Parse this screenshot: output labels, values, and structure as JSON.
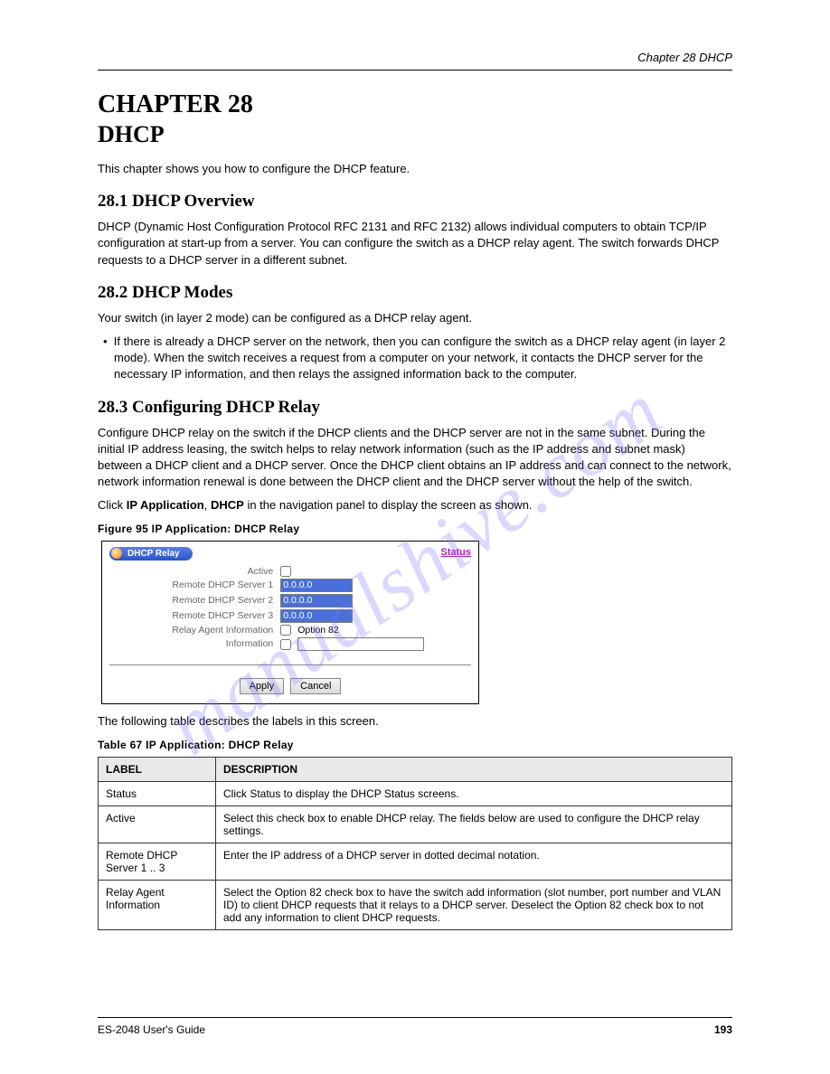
{
  "header": {
    "right": "Chapter 28 DHCP"
  },
  "chapter": {
    "num_title": "CHAPTER 28",
    "title": "DHCP"
  },
  "p_intro": "This chapter shows you how to configure the DHCP feature.",
  "s1": {
    "heading": "28.1  DHCP Overview",
    "text": "DHCP (Dynamic Host Configuration Protocol RFC 2131 and RFC 2132) allows individual computers to obtain TCP/IP configuration at start-up from a server. You can configure the switch as a DHCP relay agent. The switch forwards DHCP requests to a DHCP server in a different subnet."
  },
  "s2": {
    "heading": "28.2  DHCP Modes",
    "text": "Your switch (in layer 2 mode) can be configured as a DHCP relay agent.",
    "bullet": "If there is already a DHCP server on the network, then you can configure the switch as a DHCP relay agent (in layer 2 mode). When the switch receives a request from a computer on your network, it contacts the DHCP server for the necessary IP information, and then relays the assigned information back to the computer."
  },
  "s3": {
    "heading": "28.3  Configuring DHCP Relay",
    "p1": "Configure DHCP relay on the switch if the DHCP clients and the DHCP server are not in the same subnet. During the initial IP address leasing, the switch helps to relay network information (such as the IP address and subnet mask) between a DHCP client and a DHCP server. Once the DHCP client obtains an IP address and can connect to the network, network information renewal is done between the DHCP client and the DHCP server without the help of the switch.",
    "p2_pre": "Click ",
    "p2_b1": "IP Application",
    "p2_mid": ", ",
    "p2_b2": "DHCP",
    "p2_post": " in the navigation panel to display the screen as shown."
  },
  "figure": {
    "caption": "Figure 95   IP Application: DHCP Relay"
  },
  "ui": {
    "title": "DHCP Relay",
    "status": "Status",
    "rows": {
      "active": "Active",
      "r1": "Remote DHCP Server 1",
      "r2": "Remote DHCP Server 2",
      "r3": "Remote DHCP Server 3",
      "relay": "Relay Agent Information",
      "relay_opt": "Option 82",
      "info": "Information"
    },
    "values": {
      "ip1": "0.0.0.0",
      "ip2": "0.0.0.0",
      "ip3": "0.0.0.0",
      "info": ""
    },
    "apply": "Apply",
    "cancel": "Cancel"
  },
  "table": {
    "intro": "The following table describes the labels in this screen.",
    "caption": "Table 67   IP Application: DHCP Relay",
    "head": {
      "c1": "LABEL",
      "c2": "DESCRIPTION"
    },
    "rows": [
      {
        "label": "Status",
        "desc": "Click Status to display the DHCP Status screens."
      },
      {
        "label": "Active",
        "desc": "Select this check box to enable DHCP relay. The fields below are used to configure the DHCP relay settings."
      },
      {
        "label": "Remote DHCP Server 1 .. 3",
        "desc": "Enter the IP address of a DHCP server in dotted decimal notation."
      },
      {
        "label": "Relay Agent Information",
        "desc": "Select the Option 82 check box to have the switch add information (slot number, port number and VLAN ID) to client DHCP requests that it relays to a DHCP server. Deselect the Option 82 check box to not add any information to client DHCP requests."
      }
    ]
  },
  "footer": {
    "left": "ES-2048 User's Guide",
    "right": "193"
  },
  "watermark": "manualshive.com"
}
